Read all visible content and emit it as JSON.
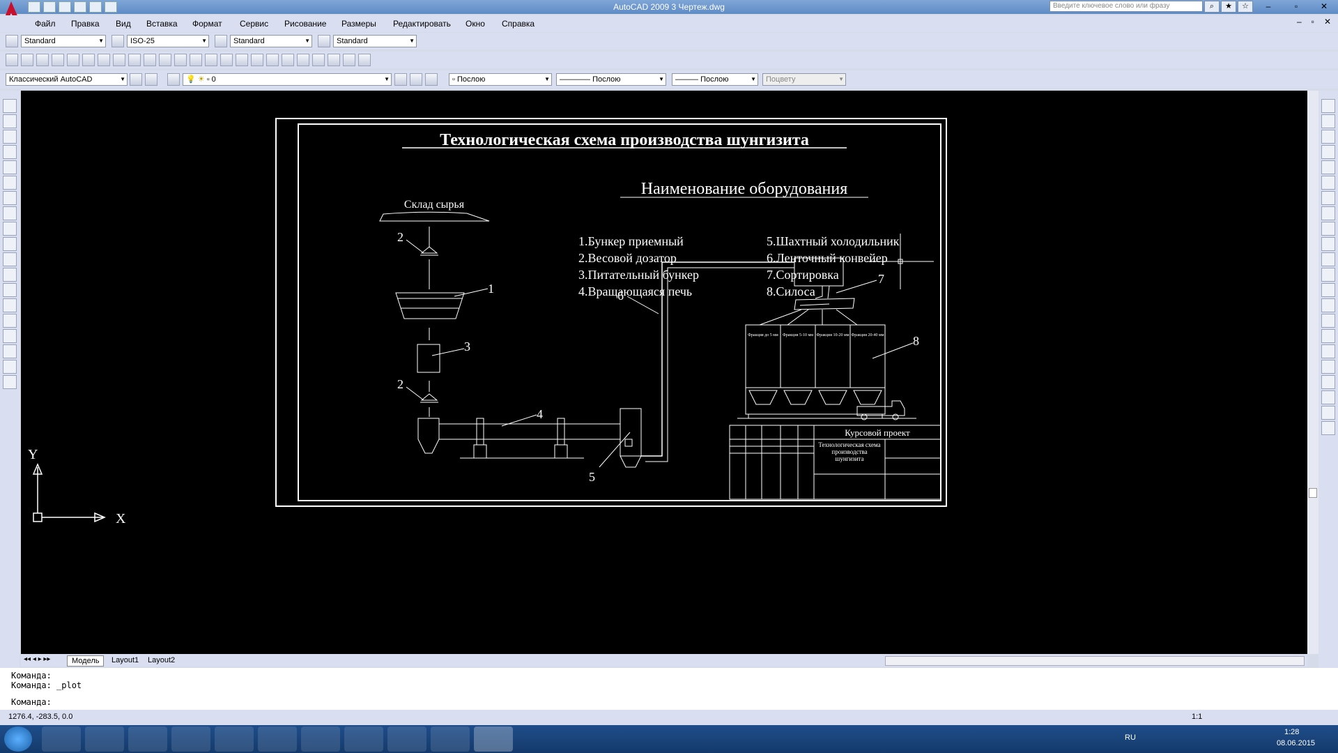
{
  "titlebar": {
    "title": "AutoCAD 2009 3 Чертеж.dwg",
    "search_placeholder": "Введите ключевое слово или фразу"
  },
  "menu": [
    "Файл",
    "Правка",
    "Вид",
    "Вставка",
    "Формат",
    "Сервис",
    "Рисование",
    "Размеры",
    "Редактировать",
    "Окно",
    "Справка"
  ],
  "styles": {
    "text_style": "Standard",
    "dim_style": "ISO-25",
    "table_style": "Standard",
    "mleader_style": "Standard"
  },
  "layers": {
    "workspace": "Классический AutoCAD",
    "layer": "0",
    "color": "Послою",
    "linetype": "Послою",
    "lineweight": "Послою",
    "plotstyle": "Поцвету"
  },
  "drawing": {
    "title": "Технологическая схема производства шунгизита",
    "raw_store": "Склад сырья",
    "legend_title": "Наименование оборудования",
    "legend_left": [
      "1.Бункер приемный",
      "2.Весовой дозатор",
      "3.Питательный бункер",
      "4.Вращающаяся печь"
    ],
    "legend_right": [
      "5.Шахтный холодильник",
      "6.Ленточный конвейер",
      "7.Сортировка",
      "8.Силоса"
    ],
    "labels": {
      "n1": "1",
      "n2a": "2",
      "n2b": "2",
      "n3": "3",
      "n4": "4",
      "n5": "5",
      "n6": "6",
      "n7": "7",
      "n8": "8"
    },
    "silos": [
      "Фракция до 5 мм",
      "Фракция 5-10 мм",
      "Фракция 10-20 мм",
      "Фракция 20-40 мм"
    ],
    "stamp": {
      "project": "Курсовой проект",
      "name": "Технологическая схема производства шунгизита"
    }
  },
  "tabs": [
    "Модель",
    "Layout1",
    "Layout2"
  ],
  "command": {
    "line1": "Команда:",
    "line2": "Команда: _plot",
    "line3": "Команда:"
  },
  "status": {
    "coords": "1276.4, -283.5, 0.0",
    "scale": "1:1"
  },
  "axes": {
    "y": "Y",
    "x": "X"
  },
  "tray": {
    "lang": "RU",
    "time": "1:28",
    "date": "08.06.2015"
  }
}
